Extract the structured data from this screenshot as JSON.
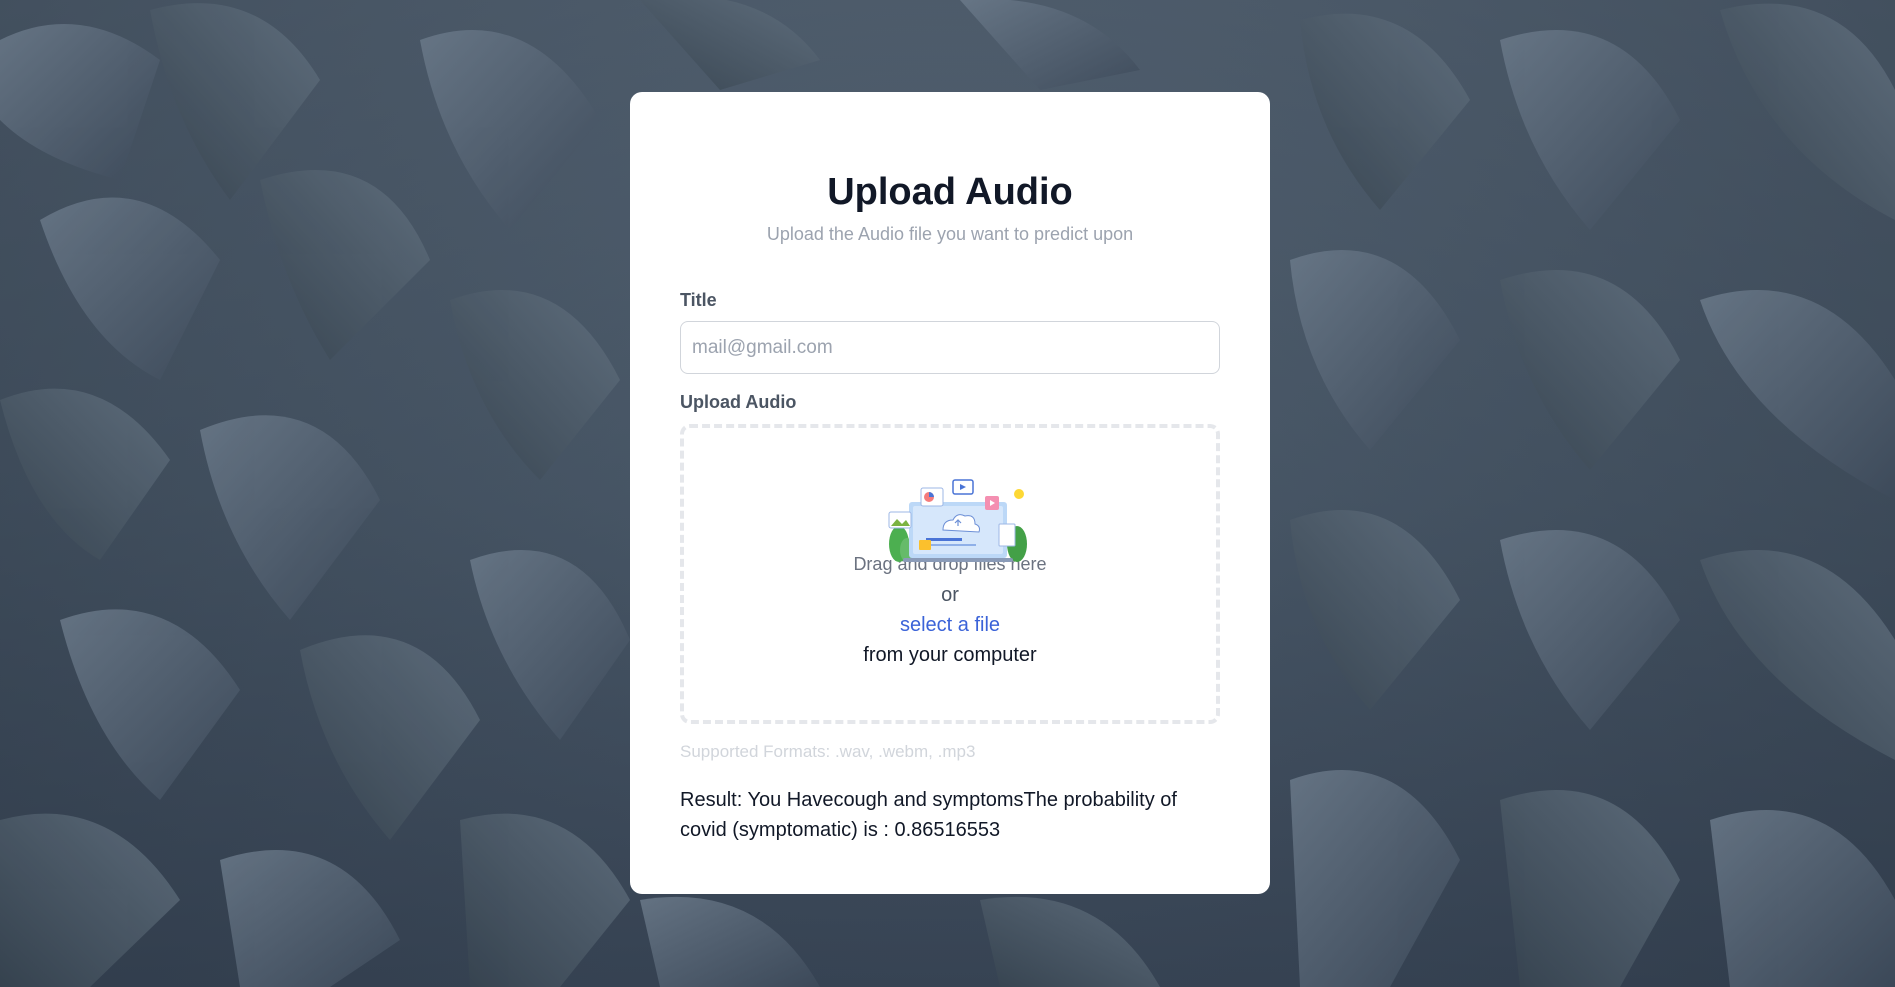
{
  "card": {
    "title": "Upload Audio",
    "subtitle": "Upload the Audio file you want to predict upon"
  },
  "form": {
    "title_label": "Title",
    "title_placeholder": "mail@gmail.com",
    "title_value": "",
    "upload_label": "Upload Audio"
  },
  "dropzone": {
    "drag_text": "Drag and drop files here",
    "or_text": "or",
    "select_link": "select a file",
    "from_text": "from your computer"
  },
  "formats_text": "Supported Formats: .wav, .webm, .mp3",
  "result_text": "Result: You Havecough and symptomsThe probability of covid (symptomatic) is : 0.86516553",
  "colors": {
    "background": "#4b5a6a",
    "card": "#ffffff",
    "link": "#3b63d8",
    "dashed_border": "#e5e7eb"
  }
}
